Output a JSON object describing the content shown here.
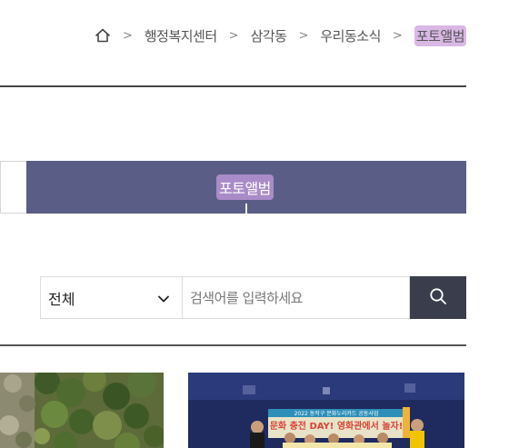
{
  "breadcrumb": {
    "home_icon": "home-icon",
    "separator": ">",
    "items": [
      "행정복지센터",
      "삼각동",
      "우리동소식"
    ],
    "current": "포토앨범"
  },
  "tab": {
    "active_label": "포토앨범"
  },
  "search": {
    "select_value": "전체",
    "placeholder": "검색어를 입력하세요",
    "button_icon": "search-icon"
  },
  "photos": {
    "card2_banner_top": "2022 동작구 문화누리카드 공동사업",
    "card2_banner_main": "문화 충전 DAY! 영화관에서 놀자!"
  },
  "colors": {
    "tab_active_bg": "#5a5e86",
    "highlight": "#d9b8e6",
    "tab_label_highlight": "#a98bc8",
    "search_button_bg": "#3a3e4c"
  }
}
